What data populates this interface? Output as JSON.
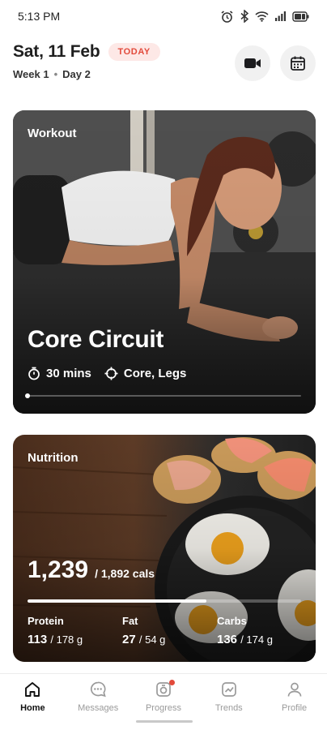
{
  "status_bar": {
    "time": "5:13 PM",
    "icons": [
      "alarm-icon",
      "bluetooth-icon",
      "wifi-icon",
      "signal-icon",
      "battery-icon"
    ]
  },
  "header": {
    "date": "Sat, 11 Feb",
    "today_badge": "TODAY",
    "week_label": "Week 1",
    "day_label": "Day 2",
    "actions": [
      "video-icon",
      "calendar-icon"
    ]
  },
  "workout": {
    "label": "Workout",
    "title": "Core Circuit",
    "duration": "30 mins",
    "focus": "Core, Legs",
    "progress": 0
  },
  "nutrition": {
    "label": "Nutrition",
    "calories": "1,239",
    "calories_goal": "/ 1,892 cals",
    "calories_progress": 0.655,
    "macros": [
      {
        "name": "Protein",
        "value": "113",
        "goal": "/ 178 g"
      },
      {
        "name": "Fat",
        "value": "27",
        "goal": "/ 54 g"
      },
      {
        "name": "Carbs",
        "value": "136",
        "goal": "/ 174 g"
      }
    ]
  },
  "nav": {
    "items": [
      {
        "label": "Home",
        "icon": "home-icon",
        "active": true
      },
      {
        "label": "Messages",
        "icon": "messages-icon",
        "active": false
      },
      {
        "label": "Progress",
        "icon": "progress-icon",
        "active": false,
        "badge": true
      },
      {
        "label": "Trends",
        "icon": "trends-icon",
        "active": false
      },
      {
        "label": "Profile",
        "icon": "profile-icon",
        "active": false
      }
    ]
  },
  "colors": {
    "accent": "#e24a3b",
    "badge_bg": "#fde8e6"
  }
}
